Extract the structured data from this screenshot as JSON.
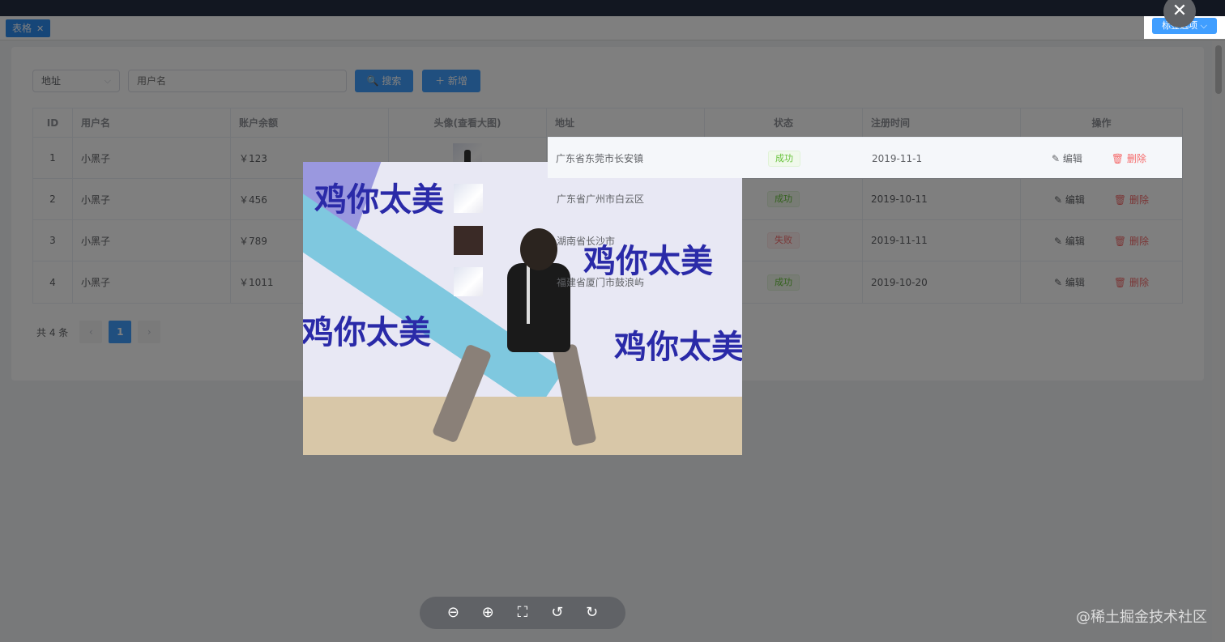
{
  "tags": {
    "active_tag": "表格",
    "close": "✕",
    "options_label": "标签选项 ⌵"
  },
  "filter": {
    "address_select": "地址",
    "username_placeholder": "用户名",
    "search_label": "🔍 搜索",
    "add_label": "＋ 新增"
  },
  "table": {
    "headers": [
      "ID",
      "用户名",
      "账户余额",
      "头像(查看大图)",
      "地址",
      "状态",
      "注册时间",
      "操作"
    ],
    "rows": [
      {
        "id": "1",
        "name": "小黑子",
        "balance": "￥123",
        "address": "广东省东莞市长安镇",
        "status": "成功",
        "date": "2019-11-1"
      },
      {
        "id": "2",
        "name": "小黑子",
        "balance": "￥456",
        "address": "广东省广州市白云区",
        "status": "成功",
        "date": "2019-10-11"
      },
      {
        "id": "3",
        "name": "小黑子",
        "balance": "￥789",
        "address": "湖南省长沙市",
        "status": "失败",
        "date": "2019-11-11"
      },
      {
        "id": "4",
        "name": "小黑子",
        "balance": "￥1011",
        "address": "福建省厦门市鼓浪屿",
        "status": "成功",
        "date": "2019-10-20"
      }
    ],
    "edit_label": "✎ 编辑",
    "delete_label": "🗑 删除"
  },
  "pager": {
    "total": "共 4 条",
    "prev": "‹",
    "page": "1",
    "next": "›"
  },
  "viewer": {
    "text": "鸡你太美",
    "close": "✕"
  },
  "toolbar": {
    "zoom_out": "⊖",
    "zoom_in": "⊕",
    "fullscreen": "⛶",
    "rotate_left": "↺",
    "rotate_right": "↻"
  },
  "watermark": "@稀土掘金技术社区",
  "colors": {
    "primary": "#409eff",
    "success": "#67c23a",
    "danger": "#f56c6c",
    "topbar": "#242f42"
  }
}
